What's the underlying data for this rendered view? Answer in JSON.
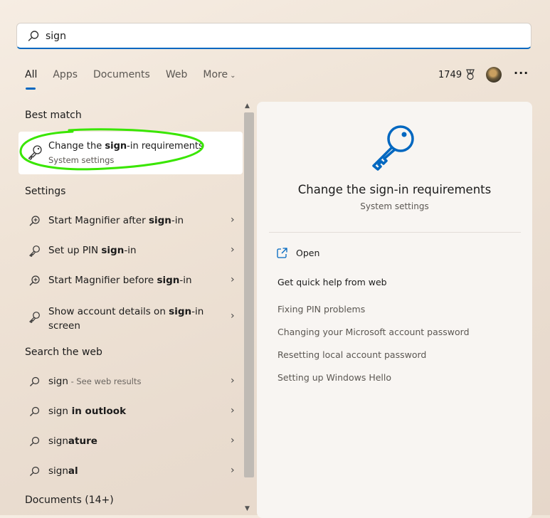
{
  "search": {
    "value": "sign",
    "placeholder": ""
  },
  "tabs": [
    {
      "label": "All"
    },
    {
      "label": "Apps"
    },
    {
      "label": "Documents"
    },
    {
      "label": "Web"
    },
    {
      "label": "More"
    }
  ],
  "header": {
    "points": "1749"
  },
  "sections": {
    "best_match": "Best match",
    "settings": "Settings",
    "search_web": "Search the web",
    "documents": "Documents (14+)"
  },
  "best_match": {
    "title_pre": "Change the ",
    "title_bold": "sign",
    "title_post": "-in requirements",
    "subtitle": "System settings"
  },
  "settings_items": [
    {
      "pre": "Start Magnifier after ",
      "bold": "sign",
      "post": "-in"
    },
    {
      "pre": "Set up PIN ",
      "bold": "sign",
      "post": "-in"
    },
    {
      "pre": "Start Magnifier before ",
      "bold": "sign",
      "post": "-in"
    },
    {
      "pre": "Show account details on ",
      "bold": "sign",
      "post": "-in screen"
    }
  ],
  "web_items": [
    {
      "pre": "sign",
      "bold": "",
      "post": "",
      "suffix": " - See web results"
    },
    {
      "pre": "sign",
      "bold": " in outlook",
      "post": "",
      "suffix": ""
    },
    {
      "pre": "sign",
      "bold": "ature",
      "post": "",
      "suffix": ""
    },
    {
      "pre": "sign",
      "bold": "al",
      "post": "",
      "suffix": ""
    }
  ],
  "detail": {
    "title": "Change the sign-in requirements",
    "subtitle": "System settings",
    "open_label": "Open",
    "help_heading": "Get quick help from web",
    "help_links": [
      "Fixing PIN problems",
      "Changing your Microsoft account password",
      "Resetting local account password",
      "Setting up Windows Hello"
    ]
  },
  "colors": {
    "accent": "#0067c0",
    "highlight_mark": "#39e600"
  }
}
